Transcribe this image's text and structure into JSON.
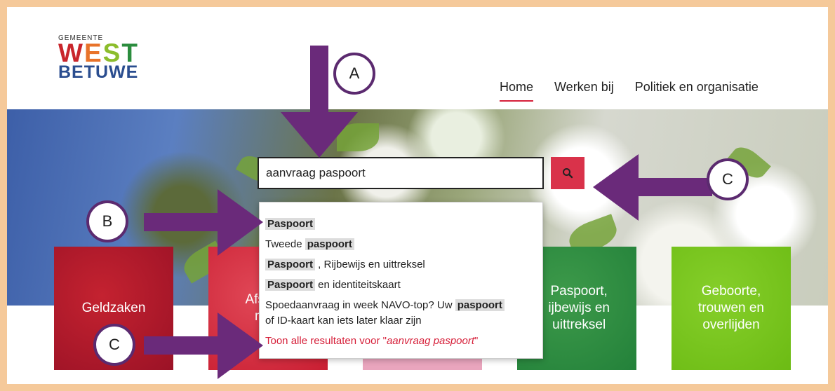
{
  "logo": {
    "small": "GEMEENTE",
    "line1": [
      "W",
      "E",
      "S",
      "T"
    ],
    "line2": "BETUWE"
  },
  "nav": {
    "items": [
      "Home",
      "Werken bij",
      "Politiek en organisatie"
    ],
    "active": "Home"
  },
  "search": {
    "value": "aanvraag paspoort",
    "button_icon": "search-icon"
  },
  "dropdown": {
    "s1": {
      "hl": "Paspoort"
    },
    "s2": {
      "pre": "Tweede ",
      "hl": "paspoort"
    },
    "s3": {
      "hl": "Paspoort",
      "post": " , Rijbewijs en uittreksel"
    },
    "s4": {
      "hl": "Paspoort",
      "post": "  en identiteitskaart"
    },
    "s5": {
      "pre": "Spoedaanvraag in week NAVO-top? Uw ",
      "hl": "paspoort",
      "post": "of ID-kaart kan iets later klaar zijn"
    },
    "all": {
      "pre": "Toon alle resultaten voor \"",
      "term": "aanvraag paspoort",
      "post": "\""
    }
  },
  "tiles": {
    "t1": "Geldzaken",
    "t2a": "Afs",
    "t2b": "ma",
    "t4a": "Paspoort,",
    "t4b": "ijbewijs en",
    "t4c": "uittreksel",
    "t5a": "Geboorte,",
    "t5b": "trouwen en",
    "t5c": "overlijden"
  },
  "annotations": {
    "a": "A",
    "b": "B",
    "c1": "C",
    "c2": "C"
  },
  "colors": {
    "accent": "#d9324a",
    "annotation": "#6a2a7a",
    "frame": "#f5c99a"
  }
}
